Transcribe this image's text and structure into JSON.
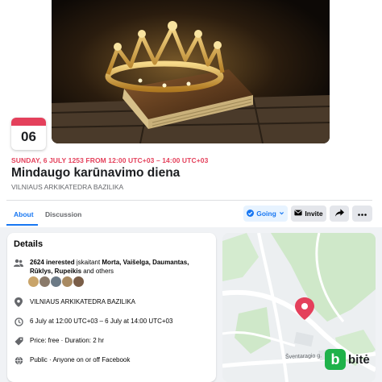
{
  "event": {
    "day": "06",
    "when": "SUNDAY, 6 JULY 1253 FROM 12:00 UTC+03 – 14:00 UTC+03",
    "title": "Mindaugo karūnavimo diena",
    "place": "VILNIAUS ARKIKATEDRA BAZILIKA"
  },
  "tabs": [
    {
      "label": "About",
      "active": true
    },
    {
      "label": "Discussion",
      "active": false
    }
  ],
  "actions": {
    "going_label": "Going",
    "invite_label": "Invite"
  },
  "details": {
    "heading": "Details",
    "interested": "2624 inerested",
    "including": " įskaitant ",
    "names_line1": "Morta, Vaišelga, Daumantas,",
    "names_line2": "Rūklys, Rupeikis",
    "others": " and others",
    "location": "VILNIAUS ARKIKATEDRA BAZILIKA",
    "dates": "6 July at 12:00 UTC+03 – 6 July at 14:00 UTC+03",
    "price": "Price: free · Duration: 2 hr",
    "privacy": "Public · Anyone on or off Facebook"
  },
  "map": {
    "street": "Šventaragio g."
  },
  "brand": {
    "letter": "b",
    "name": "bitė"
  },
  "colors": {
    "accent": "#1877f2",
    "date_red": "#e4405b",
    "brand_green": "#1fb24a"
  }
}
